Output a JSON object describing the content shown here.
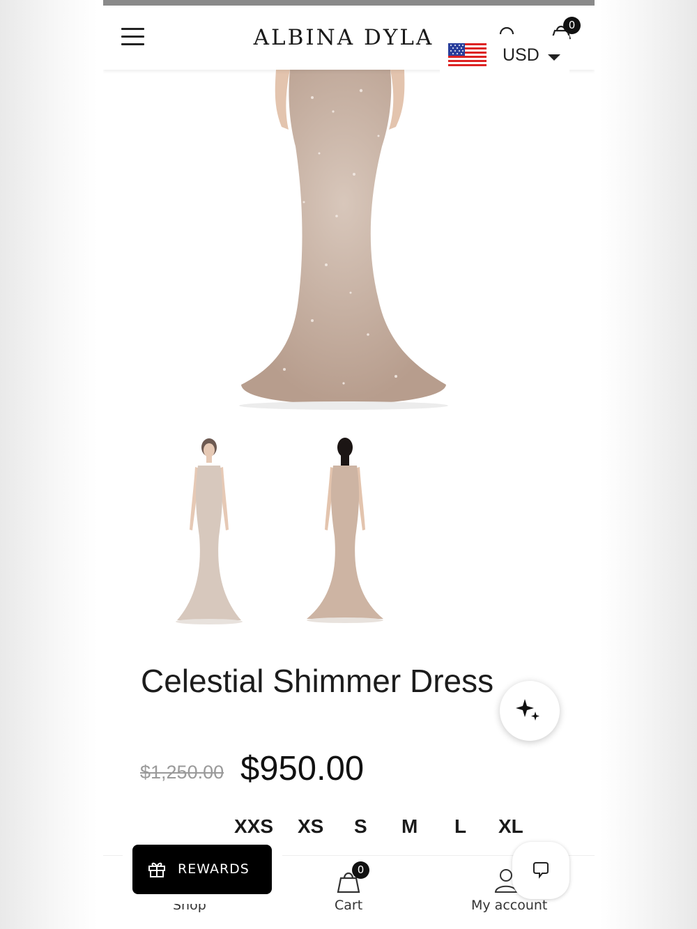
{
  "header": {
    "brand": "ALBINA DYLA",
    "cart_count": "0",
    "currency": "USD"
  },
  "product": {
    "title": "Celestial Shimmer Dress",
    "price_original": "$1,250.00",
    "price_sale": "$950.00",
    "sizes": [
      "XXS",
      "XS",
      "S",
      "M",
      "L",
      "XL"
    ],
    "gallery_thumbnail_count": 2
  },
  "bottom_nav": {
    "items": [
      {
        "label": "Shop"
      },
      {
        "label": "Cart",
        "badge": "0"
      },
      {
        "label": "My account"
      }
    ]
  },
  "widgets": {
    "rewards_label": "REWARDS"
  },
  "colors": {
    "dress": "#c9b2a3",
    "text": "#1c1c1c",
    "muted_price": "#9a9a9a",
    "black": "#000000"
  },
  "icons": [
    "menu-icon",
    "account-icon",
    "cart-icon",
    "us-flag-icon",
    "caret-down-icon",
    "sparkle-icon",
    "gift-icon",
    "chat-icon"
  ]
}
